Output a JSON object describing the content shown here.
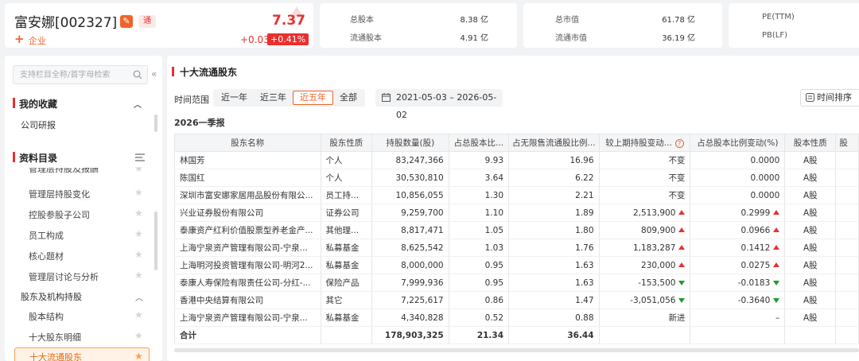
{
  "stock": {
    "name": "富安娜[002327]",
    "edit_glyph": "✎",
    "tag": "通",
    "add_label": "企业",
    "price": "7.37",
    "change": "+0.03",
    "change_pct": "+0.41%"
  },
  "metrics": [
    {
      "label": "总股本",
      "value": "8.38 亿"
    },
    {
      "label": "流通股本",
      "value": "4.91 亿"
    },
    {
      "label": "总市值",
      "value": "61.78 亿"
    },
    {
      "label": "流通市值",
      "value": "36.19 亿"
    },
    {
      "label": "PE(TTM)",
      "value": ""
    },
    {
      "label": "PB(LF)",
      "value": ""
    }
  ],
  "sidebar": {
    "search_placeholder": "支持栏目全称/首字母检索",
    "favorites_title": "我的收藏",
    "favorites_items": [
      "公司研报"
    ],
    "catalog_title": "资料目录",
    "catalog_items": [
      "管理层持股及报酬",
      "管理层持股变化",
      "控股参股子公司",
      "员工构成",
      "核心题材",
      "管理层讨论与分析"
    ],
    "group_title": "股东及机构持股",
    "group_items": [
      "股本结构",
      "十大股东明细"
    ],
    "active_item": "十大流通股东"
  },
  "main": {
    "title": "十大流通股东",
    "range_label": "时间范围",
    "range_options": [
      "近一年",
      "近三年",
      "近五年",
      "全部"
    ],
    "range_selected": "近五年",
    "date_range": "2021-05-03  –  2026-05-02",
    "sort_label": "时间排序",
    "period": "2026一季报"
  },
  "table": {
    "columns": [
      "股东名称",
      "股东性质",
      "持股数量(股)",
      "占总股本比...",
      "占无限售流通股比例...",
      "较上期持股变动...",
      "占总股本比例变动(%)",
      "股本性质",
      "股"
    ],
    "rows": [
      {
        "name": "林国芳",
        "type": "个人",
        "shares": "83,247,366",
        "total_pct": "9.93",
        "float_pct": "16.96",
        "change": "不变",
        "change_dir": "none",
        "pct_change": "0.0000",
        "pct_dir": "none",
        "nature": "A股"
      },
      {
        "name": "陈国红",
        "type": "个人",
        "shares": "30,530,810",
        "total_pct": "3.64",
        "float_pct": "6.22",
        "change": "不变",
        "change_dir": "none",
        "pct_change": "0.0000",
        "pct_dir": "none",
        "nature": "A股"
      },
      {
        "name": "深圳市富安娜家居用品股份有限公...",
        "type": "员工持...",
        "shares": "10,856,055",
        "total_pct": "1.30",
        "float_pct": "2.21",
        "change": "不变",
        "change_dir": "none",
        "pct_change": "0.0000",
        "pct_dir": "none",
        "nature": "A股"
      },
      {
        "name": "兴业证券股份有限公司",
        "type": "证券公司",
        "shares": "9,259,700",
        "total_pct": "1.10",
        "float_pct": "1.89",
        "change": "2,513,900",
        "change_dir": "up",
        "pct_change": "0.2999",
        "pct_dir": "up",
        "nature": "A股"
      },
      {
        "name": "泰康资产红利价值股票型养老金产...",
        "type": "其他理...",
        "shares": "8,817,471",
        "total_pct": "1.05",
        "float_pct": "1.80",
        "change": "809,900",
        "change_dir": "up",
        "pct_change": "0.0966",
        "pct_dir": "up",
        "nature": "A股"
      },
      {
        "name": "上海宁泉资产管理有限公司-宁泉...",
        "type": "私募基金",
        "shares": "8,625,542",
        "total_pct": "1.03",
        "float_pct": "1.76",
        "change": "1,183,287",
        "change_dir": "up",
        "pct_change": "0.1412",
        "pct_dir": "up",
        "nature": "A股"
      },
      {
        "name": "上海明河投资管理有限公司-明河2...",
        "type": "私募基金",
        "shares": "8,000,000",
        "total_pct": "0.95",
        "float_pct": "1.63",
        "change": "230,000",
        "change_dir": "up",
        "pct_change": "0.0275",
        "pct_dir": "up",
        "nature": "A股"
      },
      {
        "name": "泰康人寿保险有限责任公司-分红-...",
        "type": "保险产品",
        "shares": "7,999,936",
        "total_pct": "0.95",
        "float_pct": "1.63",
        "change": "-153,500",
        "change_dir": "down",
        "pct_change": "-0.0183",
        "pct_dir": "down",
        "nature": "A股"
      },
      {
        "name": "香港中央结算有限公司",
        "type": "其它",
        "shares": "7,225,617",
        "total_pct": "0.86",
        "float_pct": "1.47",
        "change": "-3,051,056",
        "change_dir": "down",
        "pct_change": "-0.3640",
        "pct_dir": "down",
        "nature": "A股"
      },
      {
        "name": "上海宁泉资产管理有限公司-宁泉...",
        "type": "私募基金",
        "shares": "4,340,828",
        "total_pct": "0.52",
        "float_pct": "0.88",
        "change": "新进",
        "change_dir": "none",
        "pct_change": "–",
        "pct_dir": "none",
        "nature": "A股"
      }
    ],
    "total": {
      "label": "合计",
      "shares": "178,903,325",
      "total_pct": "21.34",
      "float_pct": "36.44"
    }
  },
  "colors": {
    "up": "#e93030",
    "down": "#1a9c2d",
    "accent": "#f0642a"
  }
}
